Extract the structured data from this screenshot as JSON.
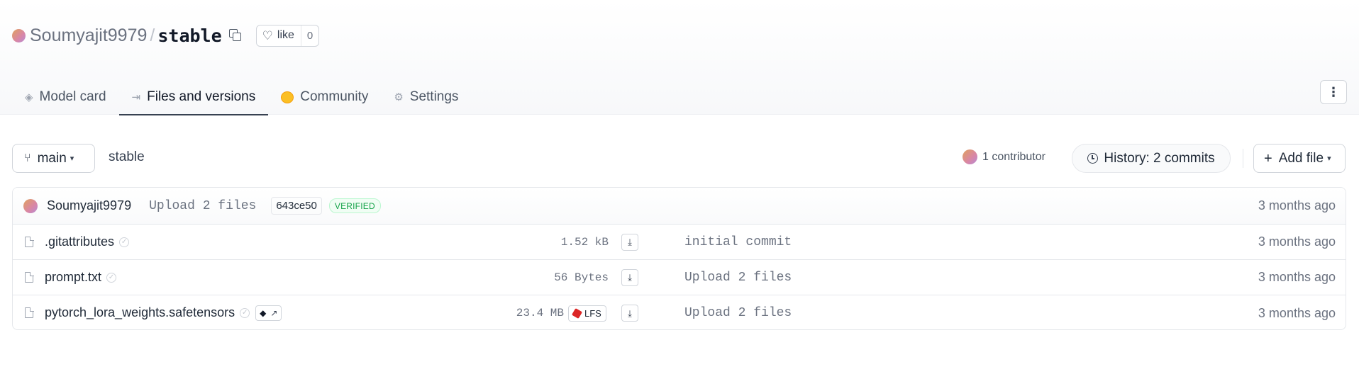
{
  "repo": {
    "owner": "Soumyajit9979",
    "separator": "/",
    "name": "stable",
    "like_label": "like",
    "like_count": "0"
  },
  "tabs": [
    {
      "label": "Model card",
      "icon": "cube-icon",
      "active": false
    },
    {
      "label": "Files and versions",
      "icon": "files-icon",
      "active": true
    },
    {
      "label": "Community",
      "icon": "hug-icon",
      "active": false
    },
    {
      "label": "Settings",
      "icon": "gear-icon",
      "active": false
    }
  ],
  "toolbar": {
    "branch": "main",
    "breadcrumb": "stable",
    "contributors": "1 contributor",
    "history": "History: 2 commits",
    "add_file": "Add file"
  },
  "last_commit": {
    "author": "Soumyajit9979",
    "message": "Upload 2 files",
    "hash": "643ce50",
    "verified": "VERIFIED",
    "time": "3 months ago"
  },
  "files": [
    {
      "name": ".gitattributes",
      "size": "1.52 kB",
      "lfs": false,
      "commit": "initial commit",
      "time": "3 months ago"
    },
    {
      "name": "prompt.txt",
      "size": "56 Bytes",
      "lfs": false,
      "commit": "Upload 2 files",
      "time": "3 months ago"
    },
    {
      "name": "pytorch_lora_weights.safetensors",
      "size": "23.4 MB",
      "lfs": true,
      "lfs_label": "LFS",
      "commit": "Upload 2 files",
      "time": "3 months ago"
    }
  ],
  "colors": {
    "accent_active_tab": "#374151",
    "verified_green": "#16a34a",
    "lfs_red": "#dc2626"
  }
}
